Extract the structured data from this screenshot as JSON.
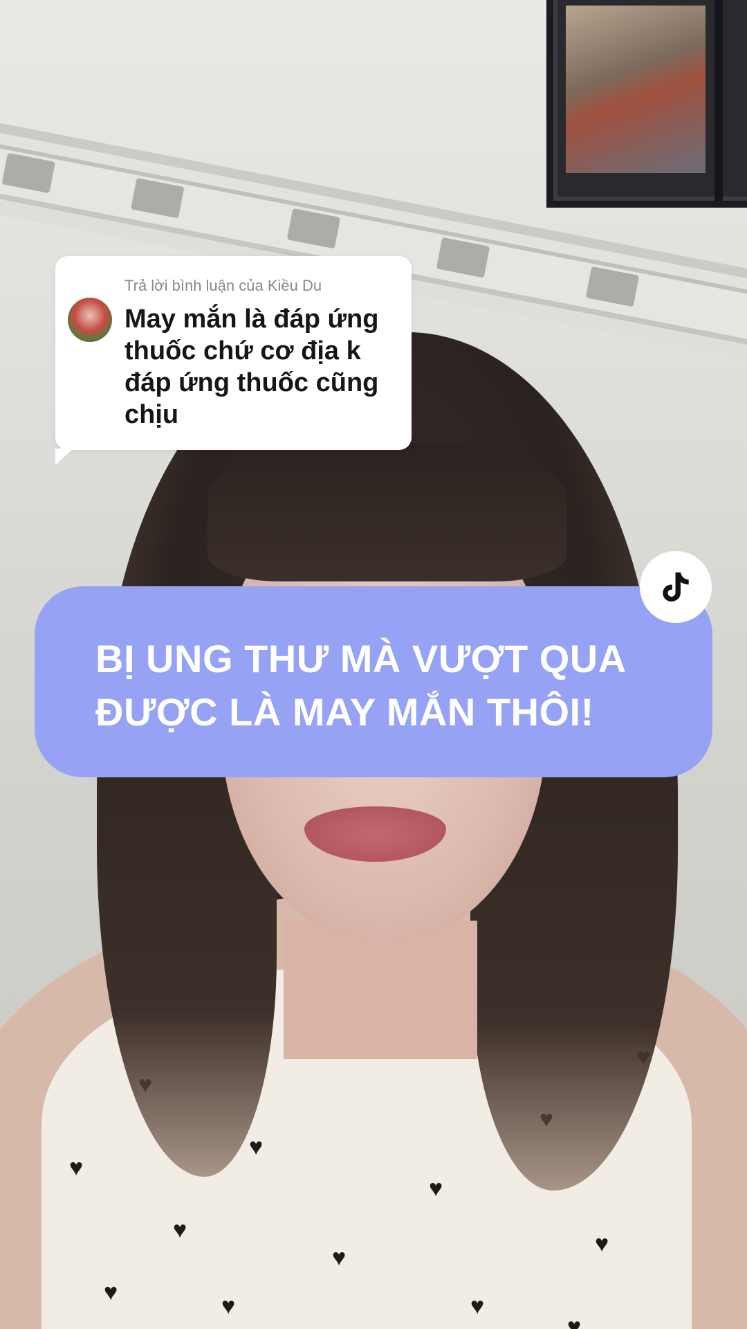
{
  "reply_comment": {
    "header": "Trả lời bình luận của Kiều Du",
    "text": "May mắn là đáp ứng thuốc chứ cơ địa k đáp ứng thuốc cũng chịu",
    "avatar_icon": "user-avatar"
  },
  "caption": {
    "line1": "BỊ UNG THƯ MÀ VƯỢT QUA",
    "line2": "ĐƯỢC LÀ MAY MẮN THÔI!",
    "background_color": "#96a3f4",
    "text_color": "#ffffff"
  },
  "badge": {
    "icon": "tiktok-logo-icon"
  }
}
